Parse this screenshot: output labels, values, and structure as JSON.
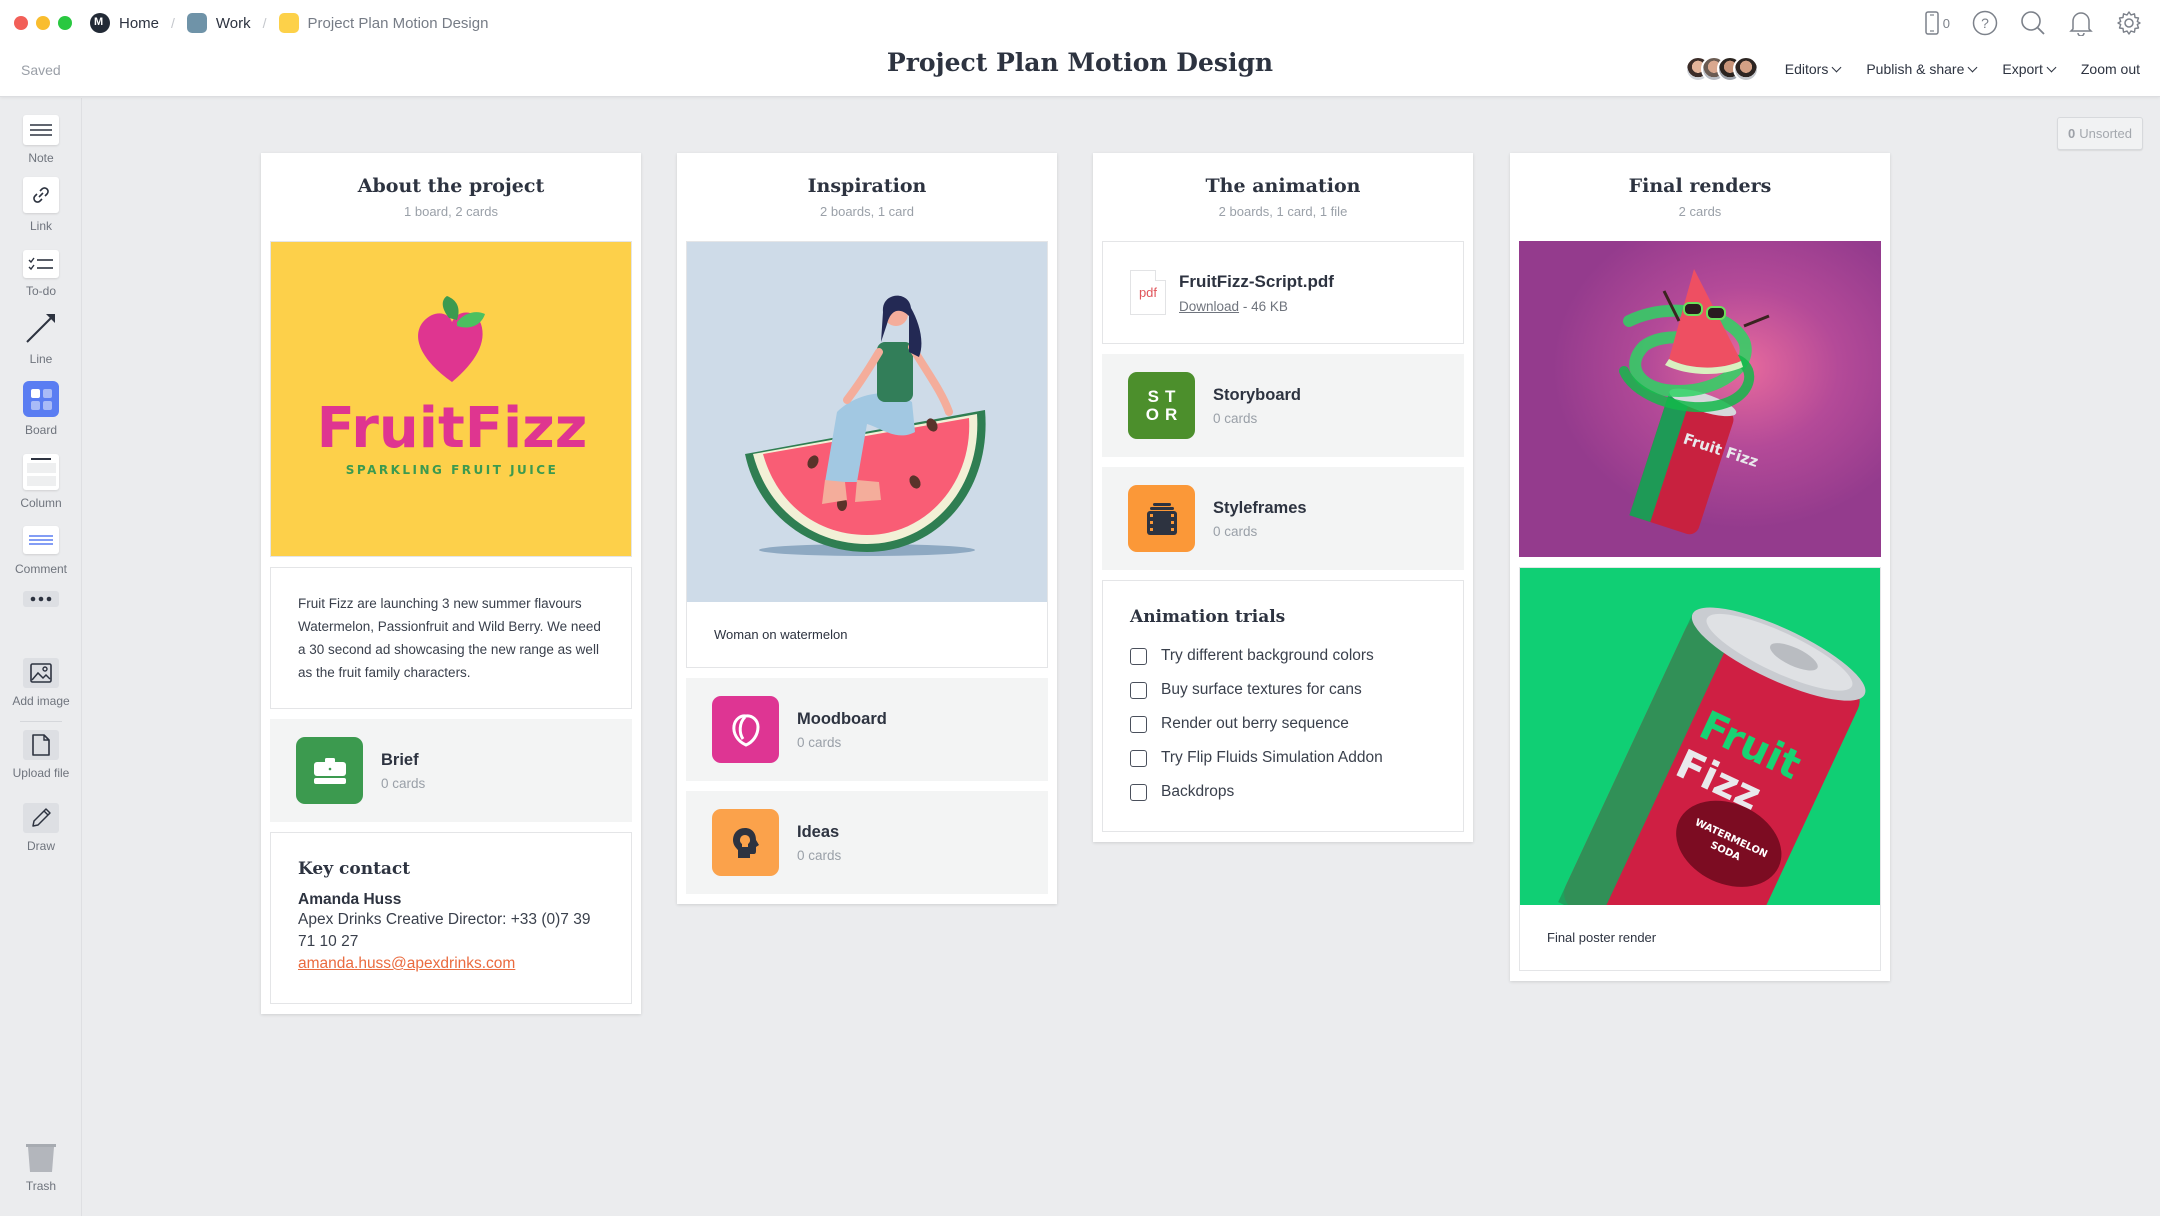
{
  "window": {
    "breadcrumb": [
      {
        "label": "Home",
        "icon": "home-logo-icon"
      },
      {
        "label": "Work",
        "icon": "work-board-icon"
      },
      {
        "label": "Project Plan Motion Design",
        "icon": "project-board-icon"
      }
    ],
    "device_count": "0"
  },
  "header": {
    "status": "Saved",
    "title": "Project Plan Motion Design",
    "editors_label": "Editors",
    "publish_label": "Publish & share",
    "export_label": "Export",
    "zoom_label": "Zoom out"
  },
  "sidebar": {
    "tools": [
      {
        "label": "Note",
        "icon": "note-icon"
      },
      {
        "label": "Link",
        "icon": "link-icon"
      },
      {
        "label": "To-do",
        "icon": "todo-icon"
      },
      {
        "label": "Line",
        "icon": "line-arrow-icon"
      },
      {
        "label": "Board",
        "icon": "board-icon"
      },
      {
        "label": "Column",
        "icon": "column-icon"
      },
      {
        "label": "Comment",
        "icon": "comment-icon"
      },
      {
        "label": "",
        "icon": "more-icon"
      },
      {
        "label": "Add image",
        "icon": "image-icon"
      },
      {
        "label": "Upload file",
        "icon": "file-icon"
      },
      {
        "label": "Draw",
        "icon": "pencil-icon"
      }
    ],
    "trash_label": "Trash"
  },
  "unsorted": {
    "count": "0",
    "label": "Unsorted"
  },
  "columns": [
    {
      "title": "About the project",
      "subtitle": "1 board, 2 cards",
      "image": {
        "brand": "FruitFizz",
        "tagline": "SPARKLING FRUIT JUICE",
        "bg_color": "#fdd04a",
        "brand_color": "#df3590"
      },
      "note": "Fruit Fizz are launching 3 new summer flavours Watermelon, Passionfruit and Wild Berry. We need a 30 second ad showcasing the new range as well as the fruit family characters.",
      "board": {
        "name": "Brief",
        "count": "0 cards",
        "color": "#3c9a4f"
      },
      "contact": {
        "heading": "Key contact",
        "name": "Amanda Huss",
        "role": "Apex Drinks Creative Director: +33 (0)7 39 71 10 27",
        "email": "amanda.huss@apexdrinks.com"
      }
    },
    {
      "title": "Inspiration",
      "subtitle": "2 boards, 1 card",
      "image_caption": "Woman on watermelon",
      "boards": [
        {
          "name": "Moodboard",
          "count": "0 cards",
          "color": "#de3593"
        },
        {
          "name": "Ideas",
          "count": "0 cards",
          "color": "#fba24b"
        }
      ]
    },
    {
      "title": "The animation",
      "subtitle": "2 boards, 1 card, 1 file",
      "file": {
        "name": "FruitFizz-Script.pdf",
        "type": "pdf",
        "download_label": "Download",
        "size": "46 KB"
      },
      "boards": [
        {
          "name": "Storyboard",
          "count": "0 cards",
          "color": "#4c8f2c",
          "icon_text": "ST OR"
        },
        {
          "name": "Styleframes",
          "count": "0 cards",
          "color": "#fb9838"
        }
      ],
      "todo": {
        "heading": "Animation trials",
        "items": [
          {
            "label": "Try different background colors",
            "checked": false
          },
          {
            "label": "Buy surface textures for cans",
            "checked": false
          },
          {
            "label": "Render out berry sequence",
            "checked": false
          },
          {
            "label": "Try Flip Fluids Simulation Addon",
            "checked": false
          },
          {
            "label": "Backdrops",
            "checked": false
          }
        ]
      }
    },
    {
      "title": "Final renders",
      "subtitle": "2 cards",
      "render1": {
        "bg_color": "#943b8d",
        "can_text": "Fruit Fizz"
      },
      "render2": {
        "bg_color": "#10cf74",
        "can_text_1": "Fruit",
        "can_text_2": "Fizz",
        "label_1": "WATERMELON",
        "label_2": "SODA"
      },
      "image_caption": "Final poster render"
    }
  ]
}
